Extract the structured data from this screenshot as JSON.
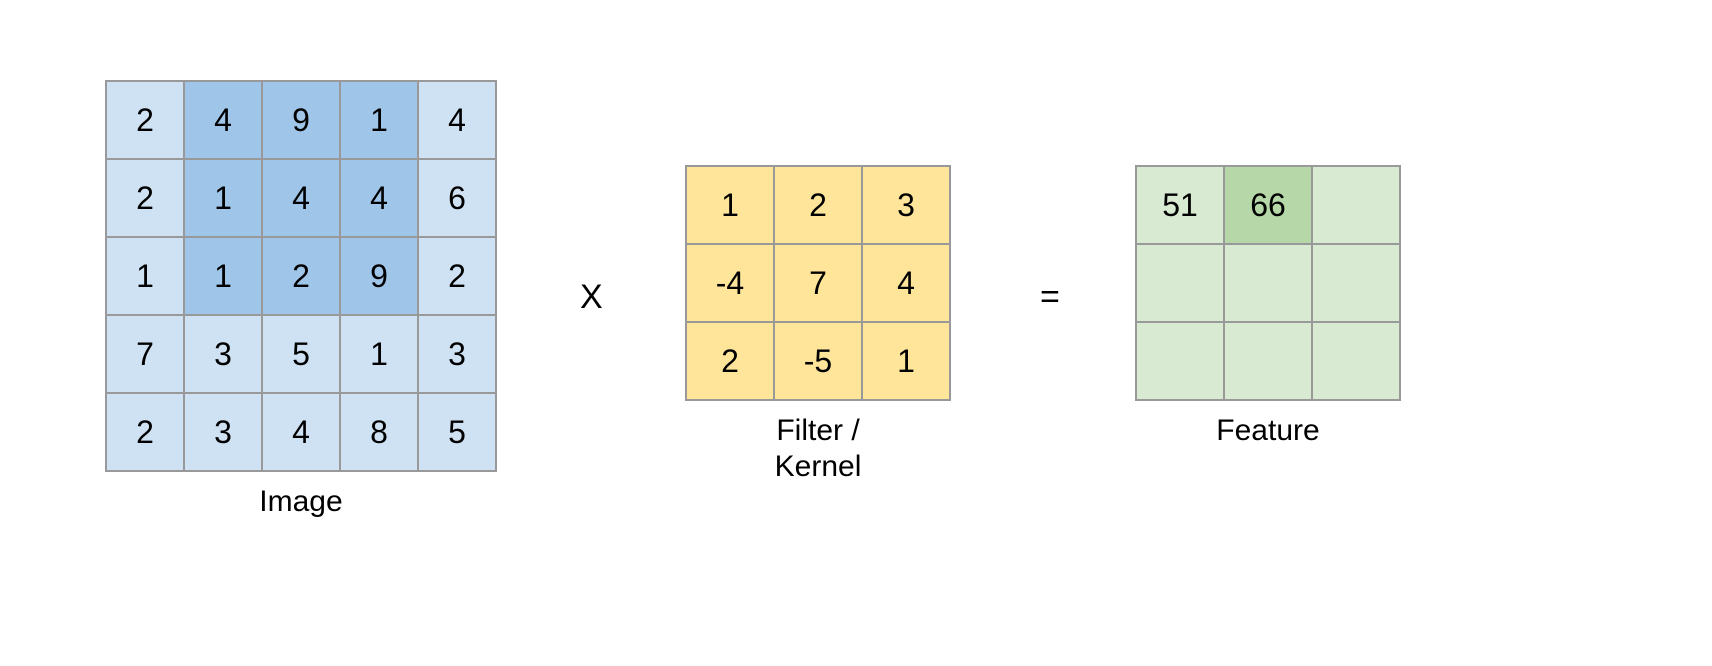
{
  "image": {
    "label": "Image",
    "rows": 5,
    "cols": 5,
    "values": [
      [
        2,
        4,
        9,
        1,
        4
      ],
      [
        2,
        1,
        4,
        4,
        6
      ],
      [
        1,
        1,
        2,
        9,
        2
      ],
      [
        7,
        3,
        5,
        1,
        3
      ],
      [
        2,
        3,
        4,
        8,
        5
      ]
    ],
    "highlight": {
      "row_start": 0,
      "row_end": 2,
      "col_start": 1,
      "col_end": 3
    }
  },
  "kernel": {
    "label": "Filter /\nKernel",
    "rows": 3,
    "cols": 3,
    "values": [
      [
        1,
        2,
        3
      ],
      [
        -4,
        7,
        4
      ],
      [
        2,
        -5,
        1
      ]
    ]
  },
  "feature": {
    "label": "Feature",
    "rows": 3,
    "cols": 3,
    "values": [
      [
        51,
        66,
        null
      ],
      [
        null,
        null,
        null
      ],
      [
        null,
        null,
        null
      ]
    ],
    "highlight": {
      "row": 0,
      "col": 1
    }
  },
  "operators": {
    "multiply": "X",
    "equals": "="
  }
}
